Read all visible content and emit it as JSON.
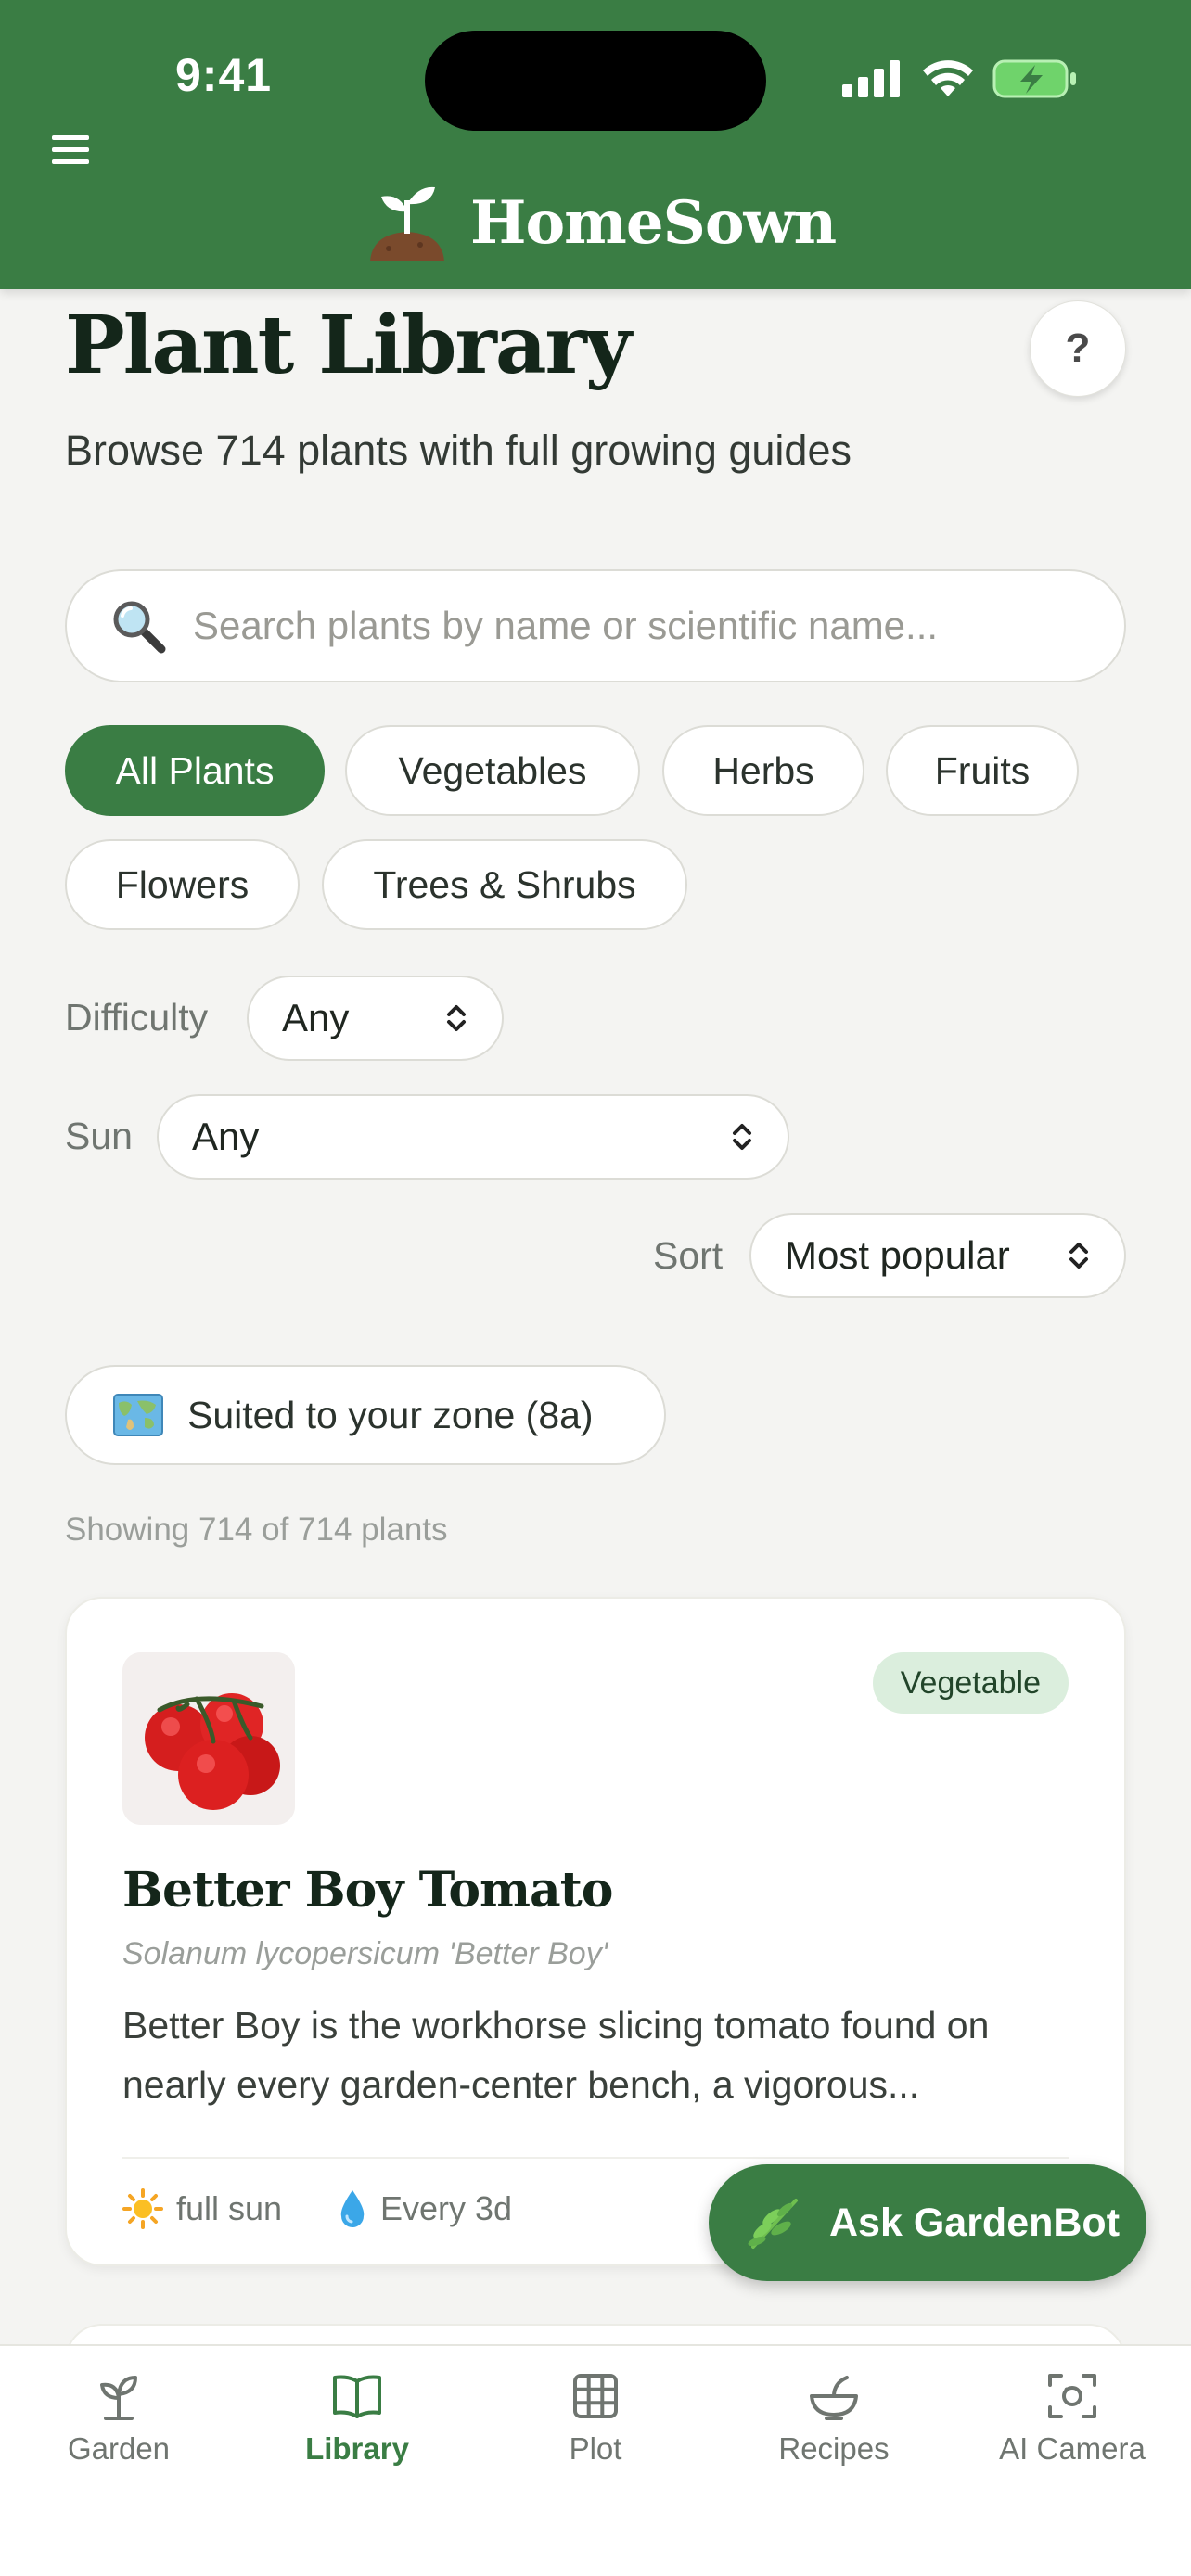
{
  "status_bar": {
    "time": "9:41"
  },
  "header": {
    "brand": "HomeSown"
  },
  "page": {
    "title": "Plant Library",
    "subtitle": "Browse 714 plants with full growing guides",
    "help_label": "?"
  },
  "search": {
    "placeholder": "Search plants by name or scientific name...",
    "value": ""
  },
  "categories": [
    {
      "label": "All Plants",
      "active": true
    },
    {
      "label": "Vegetables",
      "active": false
    },
    {
      "label": "Herbs",
      "active": false
    },
    {
      "label": "Fruits",
      "active": false
    },
    {
      "label": "Flowers",
      "active": false
    },
    {
      "label": "Trees & Shrubs",
      "active": false
    }
  ],
  "filters": {
    "difficulty": {
      "label": "Difficulty",
      "value": "Any"
    },
    "sun": {
      "label": "Sun",
      "value": "Any"
    },
    "sort": {
      "label": "Sort",
      "value": "Most popular"
    }
  },
  "zone_filter": {
    "label": "Suited to your zone (8a)"
  },
  "results": {
    "text": "Showing 714 of 714 plants"
  },
  "plants": [
    {
      "badge": "Vegetable",
      "name": "Better Boy Tomato",
      "scientific": "Solanum lycopersicum 'Better Boy'",
      "description": "Better Boy is the workhorse slicing tomato found on nearly every garden-center bench, a vigorous...",
      "sun": "full sun",
      "water": "Every 3d"
    }
  ],
  "fab": {
    "label": "Ask GardenBot"
  },
  "tabs": [
    {
      "label": "Garden",
      "icon": "sprout-icon",
      "active": false
    },
    {
      "label": "Library",
      "icon": "book-icon",
      "active": true
    },
    {
      "label": "Plot",
      "icon": "grid-icon",
      "active": false
    },
    {
      "label": "Recipes",
      "icon": "bowl-icon",
      "active": false
    },
    {
      "label": "AI Camera",
      "icon": "camera-scan-icon",
      "active": false
    }
  ],
  "colors": {
    "primary": "#3a7d44",
    "background": "#f4f4f2",
    "badge_bg": "#dbeedd"
  }
}
